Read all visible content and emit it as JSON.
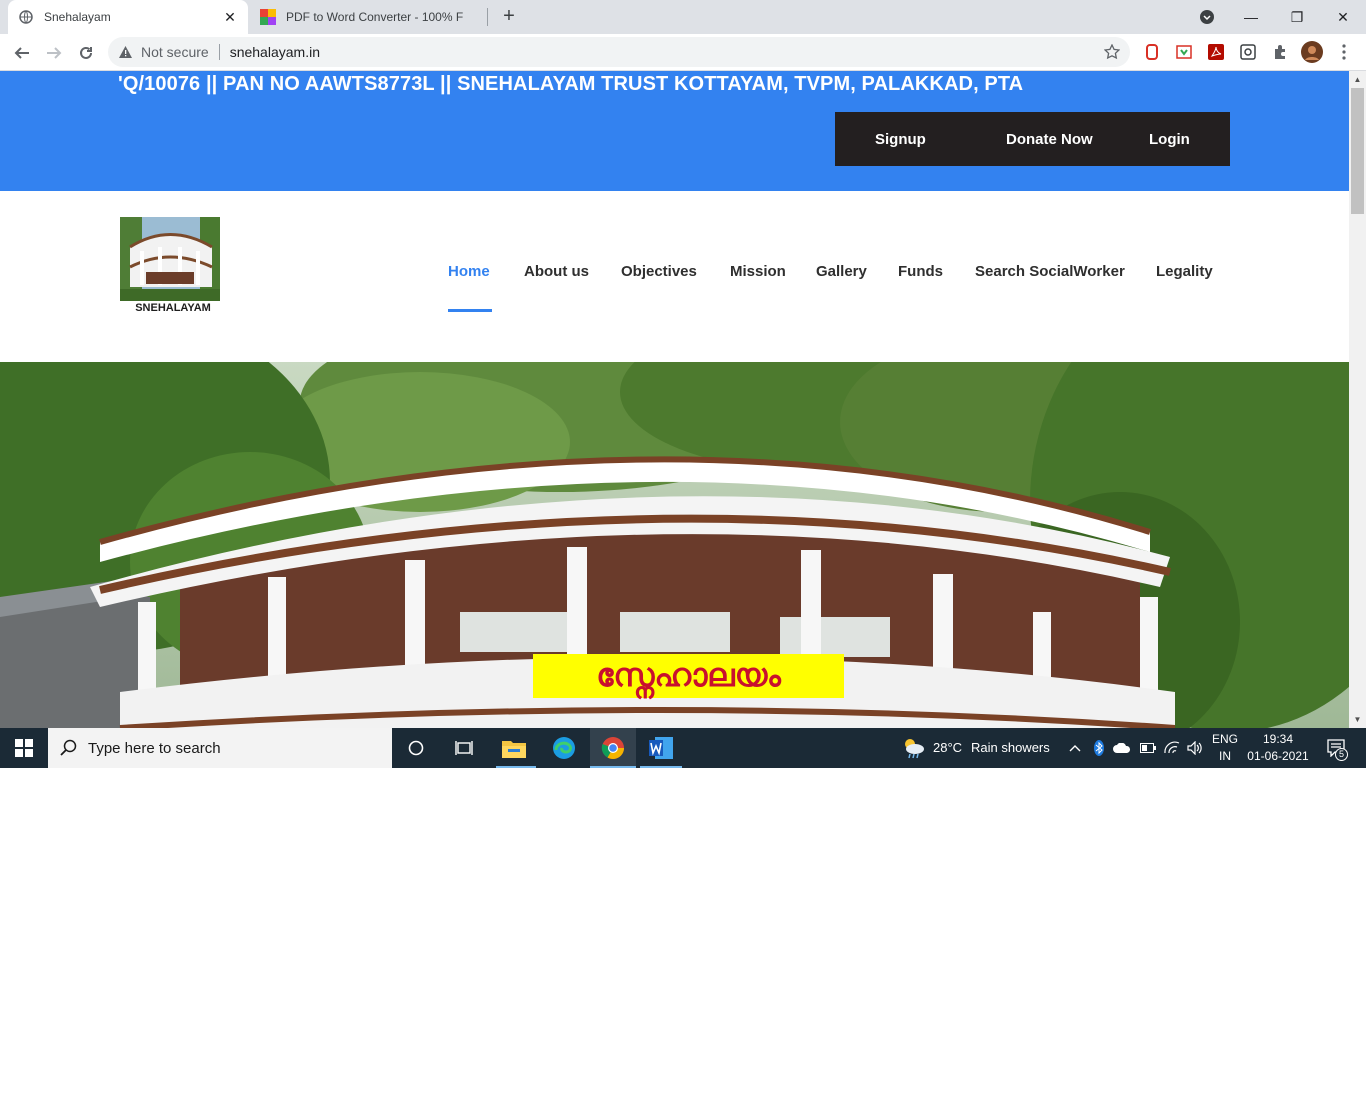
{
  "browser": {
    "tabs": [
      {
        "title": "Snehalayam",
        "active": true
      },
      {
        "title": "PDF to Word Converter - 100% F",
        "active": false
      }
    ],
    "omnibox": {
      "security_label": "Not secure",
      "url": "snehalayam.in"
    }
  },
  "site": {
    "marquee_text": "'Q/10076 || PAN NO AAWTS8773L || SNEHALAYAM TRUST KOTTAYAM, TVPM, PALAKKAD, PTA",
    "auth": {
      "signup": "Signup",
      "donate": "Donate Now",
      "login": "Login"
    },
    "logo_caption": "SNEHALAYAM",
    "nav": [
      {
        "label": "Home",
        "active": true
      },
      {
        "label": "About us"
      },
      {
        "label": "Objectives"
      },
      {
        "label": "Mission"
      },
      {
        "label": "Gallery"
      },
      {
        "label": "Funds"
      },
      {
        "label": "Search SocialWorker"
      },
      {
        "label": "Legality"
      }
    ],
    "hero_sign_text": "സ്നേഹാലയം",
    "colors": {
      "brand_blue": "#3382f0",
      "auth_bg": "#231f20",
      "sign_yellow": "#ffff00",
      "sign_text": "#c8102e"
    }
  },
  "taskbar": {
    "search_placeholder": "Type here to search",
    "weather": {
      "temp": "28°C",
      "desc": "Rain showers"
    },
    "lang": {
      "line1": "ENG",
      "line2": "IN"
    },
    "clock": {
      "time": "19:34",
      "date": "01-06-2021"
    },
    "notifications": "5"
  }
}
